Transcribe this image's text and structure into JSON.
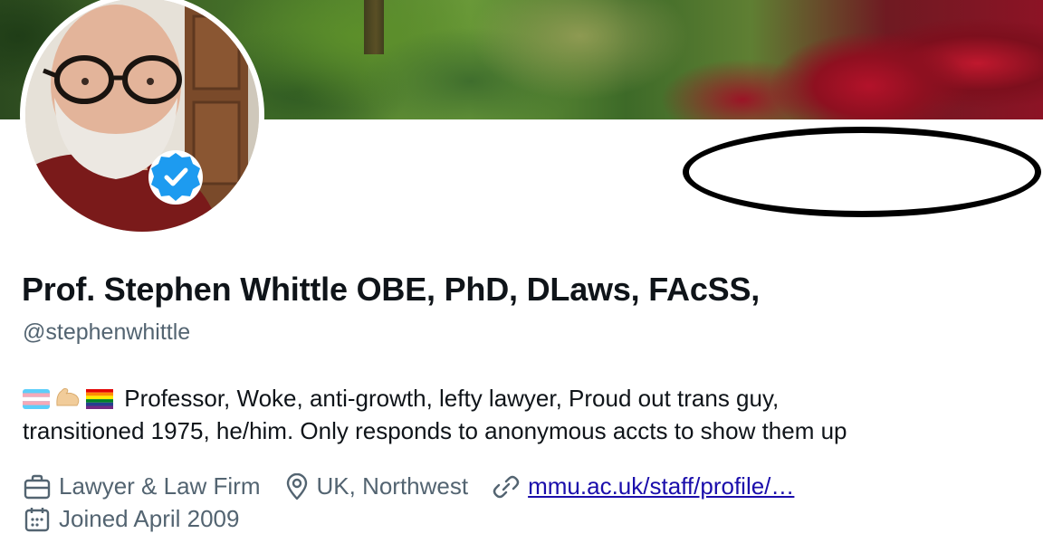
{
  "banner": {
    "icon": "garden-banner-image"
  },
  "profile": {
    "avatar_icon": "profile-photo",
    "verified_icon": "verified-badge-icon",
    "display_name": "Prof. Stephen Whittle OBE, PhD, DLaws, FAcSS,",
    "handle": "@stephenwhittle",
    "bio_emojis": [
      "transgender-flag-icon",
      "flexed-biceps-icon",
      "rainbow-flag-icon"
    ],
    "bio_line1": "Professor, Woke, anti-growth, lefty lawyer, Proud out trans guy,",
    "bio_line2": "transitioned 1975, he/him. Only responds to anonymous accts to show them up",
    "category": "Lawyer & Law Firm",
    "location": "UK, Northwest",
    "website": "mmu.ac.uk/staff/profile/…",
    "joined": "Joined April 2009"
  },
  "colors": {
    "verified": "#1d9bf0",
    "text_primary": "#0f1419",
    "text_secondary": "#536471",
    "link": "#1a0dab",
    "annotation": "#000000"
  },
  "annotation": {
    "shape": "ellipse",
    "icon": "drawn-oval-annotation"
  }
}
